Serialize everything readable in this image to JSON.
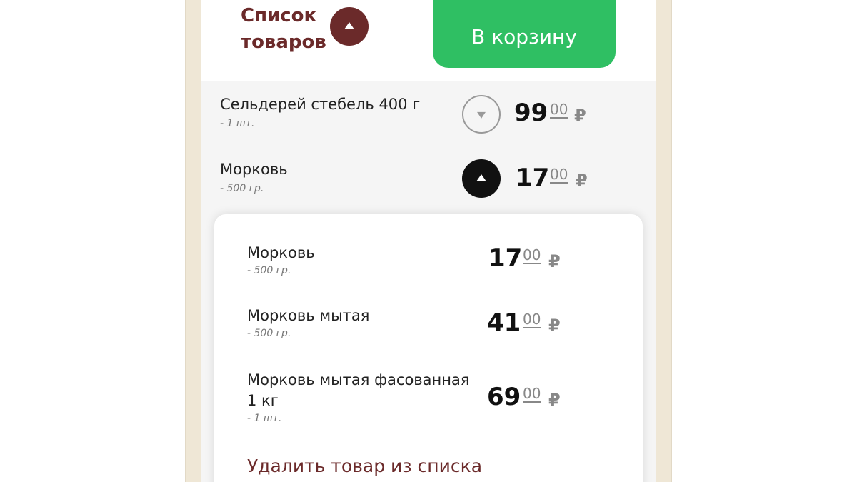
{
  "header": {
    "list_title_line1": "Список",
    "list_title_line2": "товаров",
    "cart_button": "В корзину"
  },
  "items": [
    {
      "name": "Сельдерей стебель 400 г",
      "qty": "- 1 шт.",
      "whole": "99",
      "frac": "00",
      "currency": "₽"
    },
    {
      "name": "Морковь",
      "qty": "- 500 гр.",
      "whole": "17",
      "frac": "00",
      "currency": "₽"
    }
  ],
  "alternatives": [
    {
      "name": "Морковь",
      "qty": "- 500 гр.",
      "whole": "17",
      "frac": "00",
      "currency": "₽"
    },
    {
      "name": "Морковь мытая",
      "qty": "- 500 гр.",
      "whole": "41",
      "frac": "00",
      "currency": "₽"
    },
    {
      "name": "Морковь мытая фасованная 1 кг",
      "qty": "- 1 шт.",
      "whole": "69",
      "frac": "00",
      "currency": "₽"
    }
  ],
  "delete_link": "Удалить товар из списка",
  "colors": {
    "brand_maroon": "#6b2a2a",
    "cart_green": "#2fbf63",
    "frame_beige": "#efe7d6"
  },
  "icons": {
    "collapse": "chevron-up-icon",
    "expand": "chevron-down-icon"
  }
}
